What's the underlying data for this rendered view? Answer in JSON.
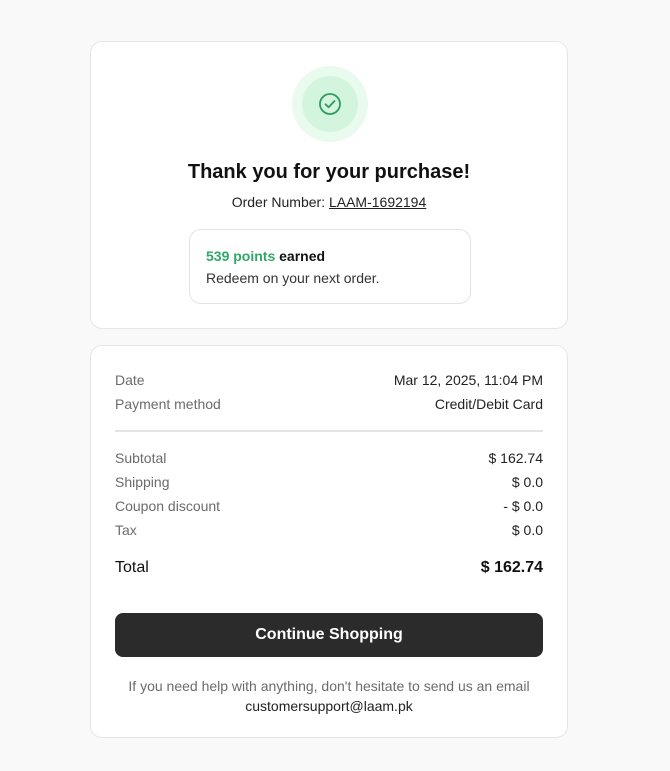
{
  "colors": {
    "accent_green": "#2fa866",
    "button_bg": "#2b2b2b",
    "page_bg": "#f9f9f9"
  },
  "confirmation": {
    "icon": "check-circle-icon",
    "title": "Thank you for your purchase!",
    "order_label": "Order Number:",
    "order_number": "LAAM-1692194"
  },
  "points": {
    "value": "539 points",
    "suffix": "earned",
    "subtitle": "Redeem on your next order."
  },
  "details": {
    "date_label": "Date",
    "date_value": "Mar 12, 2025, 11:04 PM",
    "payment_label": "Payment method",
    "payment_value": "Credit/Debit Card"
  },
  "summary": {
    "subtotal_label": "Subtotal",
    "subtotal_value": "$ 162.74",
    "shipping_label": "Shipping",
    "shipping_value": "$ 0.0",
    "coupon_label": "Coupon discount",
    "coupon_value": "- $ 0.0",
    "tax_label": "Tax",
    "tax_value": "$ 0.0",
    "total_label": "Total",
    "total_value": "$ 162.74"
  },
  "actions": {
    "continue_label": "Continue Shopping"
  },
  "help": {
    "text": "If you need help with anything, don't hesitate to send us an email",
    "email": "customersupport@laam.pk"
  }
}
